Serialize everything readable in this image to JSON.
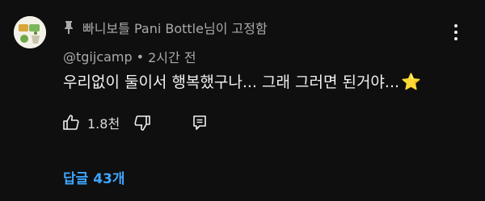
{
  "pin_label": "빠니보틀 Pani Bottle님이 고정함",
  "author": {
    "handle": "@tgijcamp",
    "separator": "•",
    "time": "2시간 전"
  },
  "comment_text": "우리없이 둘이서 행복했구나... 그래 그러면 된거야...",
  "comment_emoji": "⭐",
  "actions": {
    "like_count": "1.8천"
  },
  "replies_label": "답글 43개",
  "colors": {
    "background": "#0f0f0f",
    "text": "#f1f1f1",
    "secondary": "#aaaaaa",
    "link": "#3ea6ff",
    "star": "#f7c531"
  }
}
